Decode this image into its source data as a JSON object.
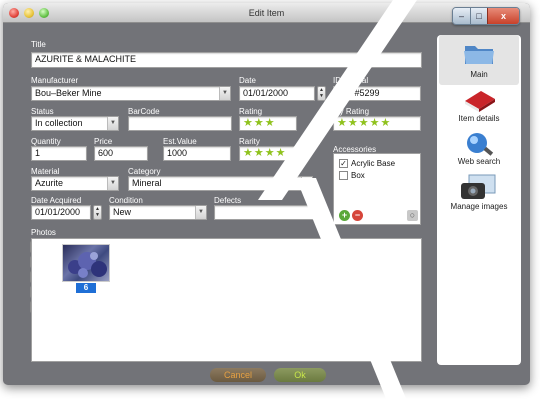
{
  "window": {
    "title": "Edit Item"
  },
  "win_controls": {
    "min": "–",
    "max": "□",
    "close": "x"
  },
  "form": {
    "title_label": "Title",
    "title_value": "AZURITE & MALACHITE",
    "manufacturer_label": "Manufacturer",
    "manufacturer_value": "Bou–Beker Mine",
    "date_label": "Date",
    "date_value": "01/01/2000",
    "id_label": "ID / Serial",
    "id_value": ".SC #5299",
    "status_label": "Status",
    "status_value": "In collection",
    "barcode_label": "BarCode",
    "barcode_value": "",
    "rating_label": "Rating",
    "rating_value": 3,
    "rating_text": "★★★",
    "my_rating_label": "My Rating",
    "my_rating_value": 5,
    "my_rating_text": "★★★★★",
    "quantity_label": "Quantity",
    "quantity_value": "1",
    "price_label": "Price",
    "price_value": "600",
    "est_value_label": "Est.Value",
    "est_value_value": "1000",
    "rarity_label": "Rarity",
    "rarity_value": 4,
    "rarity_text": "★★★★",
    "accessories_label": "Accessories",
    "material_label": "Material",
    "material_value": "Azurite",
    "category_label": "Category",
    "category_value": "Mineral",
    "date_acquired_label": "Date Acquired",
    "date_acquired_value": "01/01/2000",
    "condition_label": "Condition",
    "condition_value": "New",
    "defects_label": "Defects",
    "defects_value": "",
    "photos_label": "Photos"
  },
  "accessories": [
    {
      "label": "Acrylic Base",
      "checked": true,
      "mark": "✓"
    },
    {
      "label": "Box",
      "checked": false,
      "mark": ""
    }
  ],
  "photos": {
    "items": [
      {
        "number": "6"
      }
    ]
  },
  "buttons": {
    "cancel": "Cancel",
    "ok": "Ok"
  },
  "sidebar": {
    "items": [
      {
        "label": "Main",
        "icon": "folder-icon",
        "selected": true
      },
      {
        "label": "Item details",
        "icon": "book-icon"
      },
      {
        "label": "Web search",
        "icon": "globe-search-icon"
      },
      {
        "label": "Manage images",
        "icon": "camera-icon"
      }
    ]
  },
  "colors": {
    "window_bg": "#727378",
    "star": "#8fc21d",
    "accent": "#1f6fd6"
  }
}
